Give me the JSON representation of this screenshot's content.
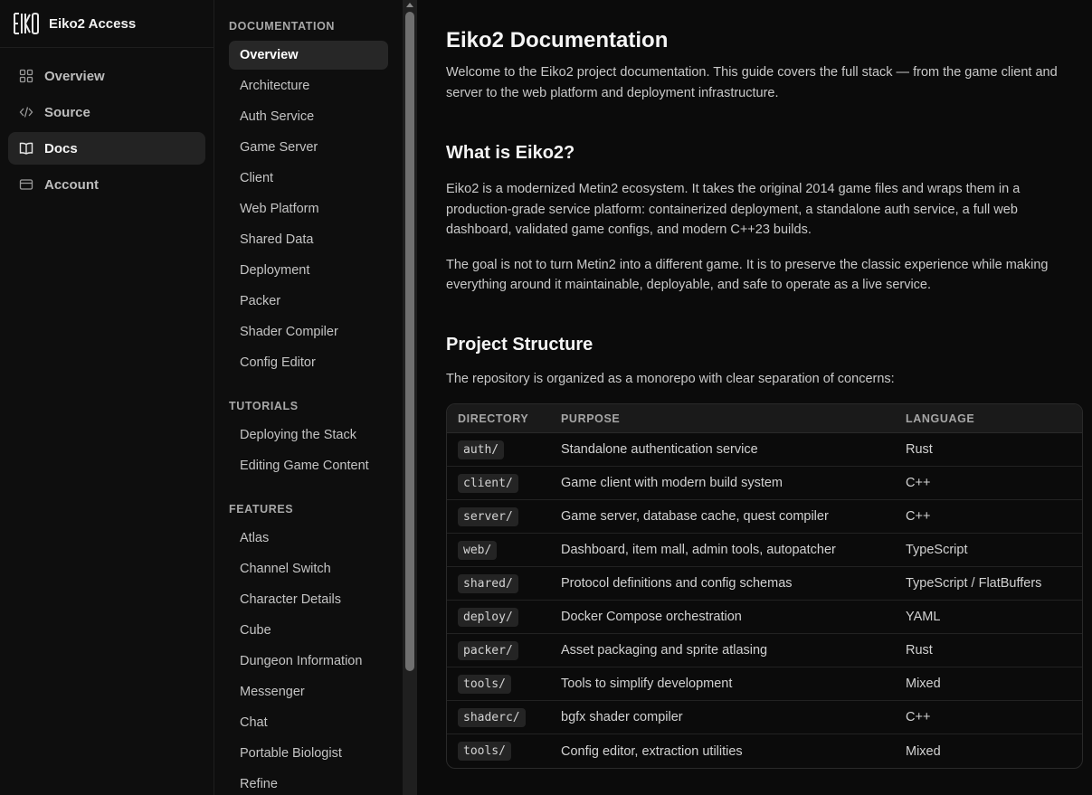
{
  "brand": {
    "name": "Eiko2 Access"
  },
  "nav": {
    "items": [
      {
        "label": "Overview",
        "icon": "grid-icon",
        "active": false
      },
      {
        "label": "Source",
        "icon": "code-icon",
        "active": false
      },
      {
        "label": "Docs",
        "icon": "book-icon",
        "active": true
      },
      {
        "label": "Account",
        "icon": "credit-card-icon",
        "active": false
      }
    ]
  },
  "docs_nav": {
    "sections": [
      {
        "title": "DOCUMENTATION",
        "links": [
          "Overview",
          "Architecture",
          "Auth Service",
          "Game Server",
          "Client",
          "Web Platform",
          "Shared Data",
          "Deployment",
          "Packer",
          "Shader Compiler",
          "Config Editor"
        ]
      },
      {
        "title": "TUTORIALS",
        "links": [
          "Deploying the Stack",
          "Editing Game Content"
        ]
      },
      {
        "title": "FEATURES",
        "links": [
          "Atlas",
          "Channel Switch",
          "Character Details",
          "Cube",
          "Dungeon Information",
          "Messenger",
          "Chat",
          "Portable Biologist",
          "Refine"
        ]
      }
    ],
    "active_link": "Overview"
  },
  "page": {
    "title": "Eiko2 Documentation",
    "intro": "Welcome to the Eiko2 project documentation. This guide covers the full stack — from the game client and server to the web platform and deployment infrastructure.",
    "what_heading": "What is Eiko2?",
    "what_p1": "Eiko2 is a modernized Metin2 ecosystem. It takes the original 2014 game files and wraps them in a production-grade service platform: containerized deployment, a standalone auth service, a full web dashboard, validated game configs, and modern C++23 builds.",
    "what_p2": "The goal is not to turn Metin2 into a different game. It is to preserve the classic experience while making everything around it maintainable, deployable, and safe to operate as a live service.",
    "structure_heading": "Project Structure",
    "structure_intro": "The repository is organized as a monorepo with clear separation of concerns:"
  },
  "table": {
    "headers": [
      "DIRECTORY",
      "PURPOSE",
      "LANGUAGE"
    ],
    "rows": [
      [
        "auth/",
        "Standalone authentication service",
        "Rust"
      ],
      [
        "client/",
        "Game client with modern build system",
        "C++"
      ],
      [
        "server/",
        "Game server, database cache, quest compiler",
        "C++"
      ],
      [
        "web/",
        "Dashboard, item mall, admin tools, autopatcher",
        "TypeScript"
      ],
      [
        "shared/",
        "Protocol definitions and config schemas",
        "TypeScript / FlatBuffers"
      ],
      [
        "deploy/",
        "Docker Compose orchestration",
        "YAML"
      ],
      [
        "packer/",
        "Asset packaging and sprite atlasing",
        "Rust"
      ],
      [
        "tools/",
        "Tools to simplify development",
        "Mixed"
      ],
      [
        "shaderc/",
        "bgfx shader compiler",
        "C++"
      ],
      [
        "tools/",
        "Config editor, extraction utilities",
        "Mixed"
      ]
    ]
  }
}
